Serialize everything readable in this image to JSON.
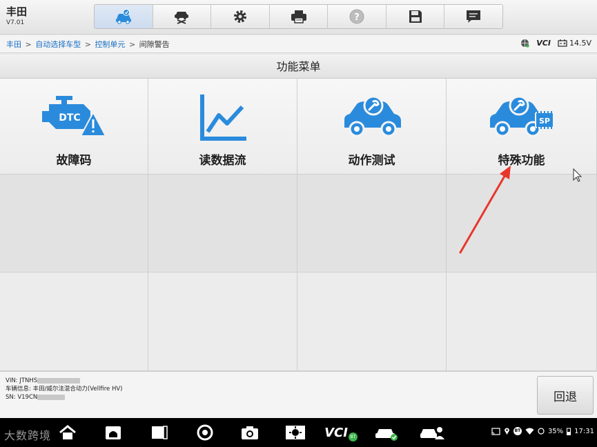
{
  "header": {
    "brand": "丰田",
    "version": "V7.01",
    "tools": [
      {
        "icon": "car-diagnose-icon",
        "active": true
      },
      {
        "icon": "car-lift-icon",
        "active": false
      },
      {
        "icon": "gear-icon",
        "active": false
      },
      {
        "icon": "printer-icon",
        "active": false
      },
      {
        "icon": "help-icon",
        "active": false
      },
      {
        "icon": "save-icon",
        "active": false
      },
      {
        "icon": "chat-icon",
        "active": false
      }
    ]
  },
  "breadcrumb": {
    "items": [
      "丰田",
      "自动选择车型",
      "控制单元"
    ],
    "current": "间隙警告",
    "separator": ">"
  },
  "status": {
    "vci_label": "VCI",
    "battery_voltage": "14.5V"
  },
  "menu": {
    "title": "功能菜单",
    "functions": [
      {
        "label": "故障码",
        "icon": "dtc-engine-warning-icon",
        "icon_text": "DTC"
      },
      {
        "label": "读数据流",
        "icon": "line-chart-icon"
      },
      {
        "label": "动作测试",
        "icon": "car-wrench-icon"
      },
      {
        "label": "特殊功能",
        "icon": "car-wrench-sp-icon",
        "icon_text": "SP"
      }
    ]
  },
  "footer": {
    "vin": "VIN: JTNHS",
    "vehicle_info": "车辆信息: 丰田/威尔法混合动力(Vellfire HV)",
    "sn": "SN: V19CN",
    "back_label": "回退"
  },
  "navbar": {
    "watermark": "大数跨境",
    "vci_label": "VCI",
    "vci_badge": "BT",
    "battery": "35%",
    "time": "17:31"
  },
  "colors": {
    "accent_blue": "#2a8bdc",
    "link_blue": "#1a6fc4",
    "arrow_red": "#e8362b"
  }
}
